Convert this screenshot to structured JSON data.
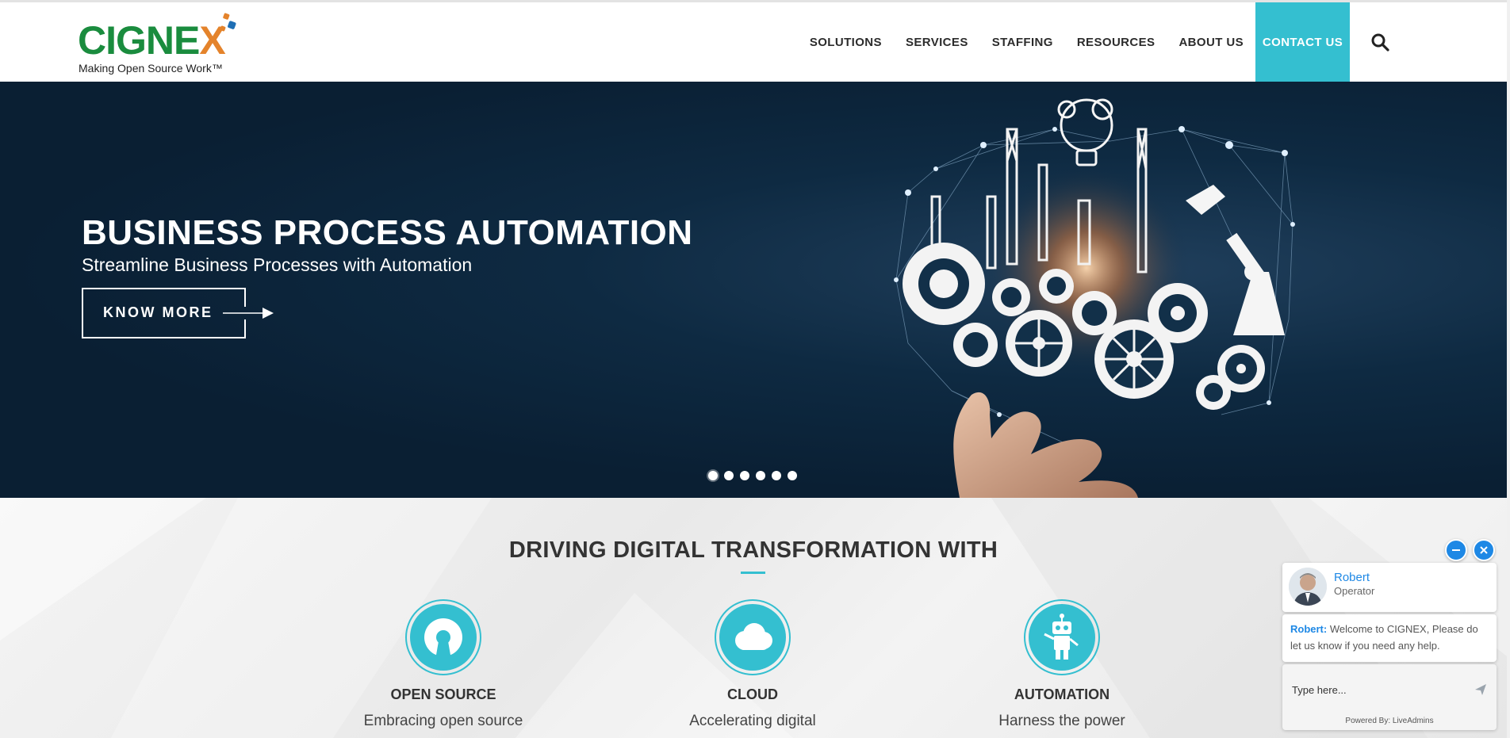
{
  "header": {
    "logo": {
      "word": "CIGNE",
      "word_end": "X",
      "tagline": "Making Open Source Work™"
    },
    "nav": [
      {
        "label": "SOLUTIONS"
      },
      {
        "label": "SERVICES"
      },
      {
        "label": "STAFFING"
      },
      {
        "label": "RESOURCES"
      },
      {
        "label": "ABOUT US"
      }
    ],
    "contact_label": "CONTACT US",
    "search_icon": "search-icon",
    "accent_color": "#34bfd0"
  },
  "hero": {
    "title": "BUSINESS PROCESS AUTOMATION",
    "subtitle": "Streamline Business Processes with Automation",
    "button_label": "KNOW MORE",
    "slide_count": 6,
    "active_slide": 1,
    "background_color": "#0a1f33"
  },
  "section": {
    "title": "DRIVING DIGITAL TRANSFORMATION WITH",
    "features": [
      {
        "title": "OPEN SOURCE",
        "desc": "Embracing open source",
        "icon": "open-source-icon"
      },
      {
        "title": "CLOUD",
        "desc": "Accelerating digital",
        "icon": "cloud-icon"
      },
      {
        "title": "AUTOMATION",
        "desc": "Harness the power",
        "icon": "robot-icon"
      }
    ]
  },
  "chat": {
    "operator_name": "Robert",
    "operator_role": "Operator",
    "message_author": "Robert:",
    "message_text": "Welcome to CIGNEX, Please do let us know if you need any help.",
    "input_placeholder": "Type here...",
    "powered_by": "Powered By: LiveAdmins",
    "accent_color": "#1e88e5"
  }
}
